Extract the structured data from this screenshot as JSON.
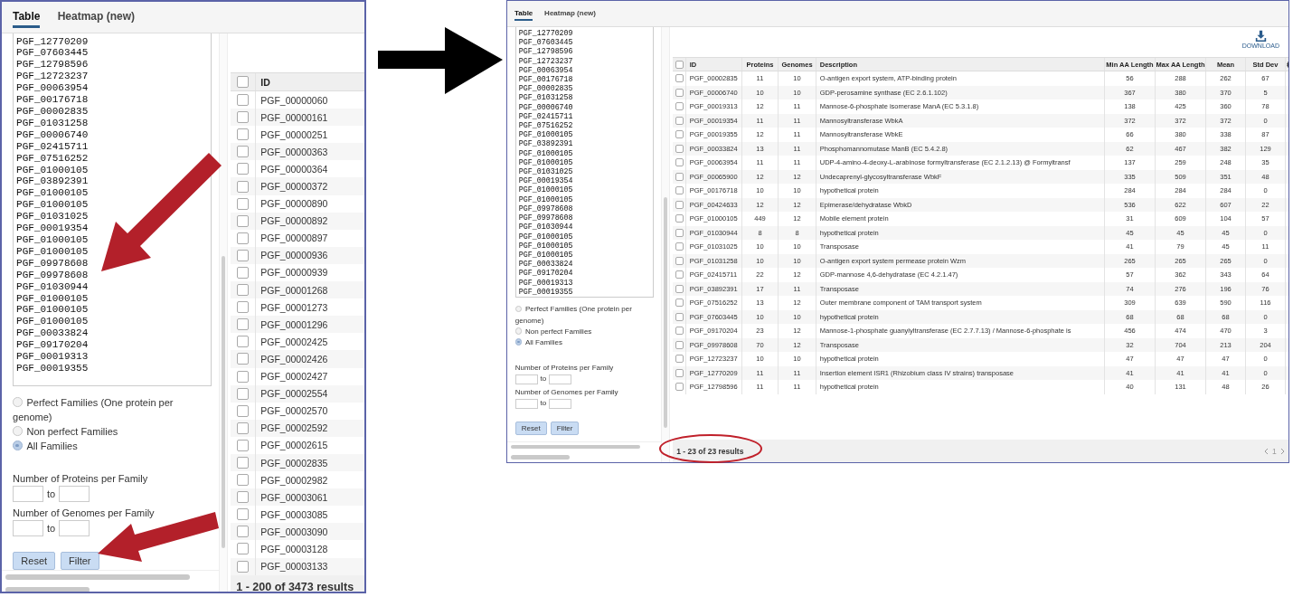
{
  "screens": [
    {
      "tabs": [
        {
          "label": "Table",
          "selected": true
        },
        {
          "label": "Heatmap (new)",
          "selected": false
        }
      ],
      "id_list": [
        "PGF_12770209",
        "PGF_07603445",
        "PGF_12798596",
        "PGF_12723237",
        "PGF_00063954",
        "PGF_00176718",
        "PGF_00002835",
        "PGF_01031258",
        "PGF_00006740",
        "PGF_02415711",
        "PGF_07516252",
        "PGF_01000105",
        "PGF_03892391",
        "PGF_01000105",
        "PGF_01000105",
        "PGF_01031025",
        "PGF_00019354",
        "PGF_01000105",
        "PGF_01000105",
        "PGF_09978608",
        "PGF_09978608",
        "PGF_01030944",
        "PGF_01000105",
        "PGF_01000105",
        "PGF_01000105",
        "PGF_00033824",
        "PGF_09170204",
        "PGF_00019313",
        "PGF_00019355"
      ],
      "family_options": [
        {
          "label": "Perfect Families (One protein per genome)",
          "selected": false
        },
        {
          "label": "Non perfect Families",
          "selected": false
        },
        {
          "label": "All Families",
          "selected": true
        }
      ],
      "ranges": [
        {
          "label": "Number of Proteins per Family",
          "to": "to"
        },
        {
          "label": "Number of Genomes per Family",
          "to": "to"
        }
      ],
      "buttons": [
        "Reset",
        "Filter"
      ],
      "table": {
        "select_all": {
          "checked": false
        },
        "columns": [
          "ID"
        ],
        "rows": [
          {
            "checked": false,
            "cells": [
              "PGF_00000060"
            ]
          },
          {
            "checked": false,
            "cells": [
              "PGF_00000161"
            ]
          },
          {
            "checked": false,
            "cells": [
              "PGF_00000251"
            ]
          },
          {
            "checked": false,
            "cells": [
              "PGF_00000363"
            ]
          },
          {
            "checked": false,
            "cells": [
              "PGF_00000364"
            ]
          },
          {
            "checked": false,
            "cells": [
              "PGF_00000372"
            ]
          },
          {
            "checked": false,
            "cells": [
              "PGF_00000890"
            ]
          },
          {
            "checked": false,
            "cells": [
              "PGF_00000892"
            ]
          },
          {
            "checked": false,
            "cells": [
              "PGF_00000897"
            ]
          },
          {
            "checked": false,
            "cells": [
              "PGF_00000936"
            ]
          },
          {
            "checked": false,
            "cells": [
              "PGF_00000939"
            ]
          },
          {
            "checked": false,
            "cells": [
              "PGF_00001268"
            ]
          },
          {
            "checked": false,
            "cells": [
              "PGF_00001273"
            ]
          },
          {
            "checked": false,
            "cells": [
              "PGF_00001296"
            ]
          },
          {
            "checked": false,
            "cells": [
              "PGF_00002425"
            ]
          },
          {
            "checked": false,
            "cells": [
              "PGF_00002426"
            ]
          },
          {
            "checked": false,
            "cells": [
              "PGF_00002427"
            ]
          },
          {
            "checked": false,
            "cells": [
              "PGF_00002554"
            ]
          },
          {
            "checked": false,
            "cells": [
              "PGF_00002570"
            ]
          },
          {
            "checked": false,
            "cells": [
              "PGF_00002592"
            ]
          },
          {
            "checked": false,
            "cells": [
              "PGF_00002615"
            ]
          },
          {
            "checked": false,
            "cells": [
              "PGF_00002835"
            ]
          },
          {
            "checked": false,
            "cells": [
              "PGF_00002982"
            ]
          },
          {
            "checked": false,
            "cells": [
              "PGF_00003061"
            ]
          },
          {
            "checked": false,
            "cells": [
              "PGF_00003085"
            ]
          },
          {
            "checked": false,
            "cells": [
              "PGF_00003090"
            ]
          },
          {
            "checked": false,
            "cells": [
              "PGF_00003128"
            ]
          },
          {
            "checked": false,
            "cells": [
              "PGF_00003133"
            ]
          }
        ]
      },
      "results": "1 - 200 of 3473 results"
    },
    {
      "tabs": [
        {
          "label": "Table",
          "selected": true
        },
        {
          "label": "Heatmap (new)",
          "selected": false
        }
      ],
      "id_list": [
        "PGF_12770209",
        "PGF_07603445",
        "PGF_12798596",
        "PGF_12723237",
        "PGF_00063954",
        "PGF_00176718",
        "PGF_00002835",
        "PGF_01031258",
        "PGF_00006740",
        "PGF_02415711",
        "PGF_07516252",
        "PGF_01000105",
        "PGF_03892391",
        "PGF_01000105",
        "PGF_01000105",
        "PGF_01031025",
        "PGF_00019354",
        "PGF_01000105",
        "PGF_01000105",
        "PGF_09978608",
        "PGF_09978608",
        "PGF_01030944",
        "PGF_01000105",
        "PGF_01000105",
        "PGF_01000105",
        "PGF_00033824",
        "PGF_09170204",
        "PGF_00019313",
        "PGF_00019355"
      ],
      "family_options": [
        {
          "label": "Perfect Families (One protein per genome)",
          "selected": false
        },
        {
          "label": "Non perfect Families",
          "selected": false
        },
        {
          "label": "All Families",
          "selected": true
        }
      ],
      "ranges": [
        {
          "label": "Number of Proteins per Family",
          "to": "to"
        },
        {
          "label": "Number of Genomes per Family",
          "to": "to"
        }
      ],
      "buttons": [
        "Reset",
        "Filter"
      ],
      "download": "DOWNLOAD",
      "table": {
        "select_all": {
          "checked": false
        },
        "columns": [
          "ID",
          "Proteins",
          "Genomes",
          "Description",
          "Min AA Length",
          "Max AA Length",
          "Mean",
          "Std Dev"
        ],
        "rows": [
          {
            "checked": false,
            "cells": [
              "PGF_00002835",
              "11",
              "10",
              "O-antigen export system, ATP-binding protein",
              "56",
              "288",
              "262",
              "67"
            ]
          },
          {
            "checked": false,
            "cells": [
              "PGF_00006740",
              "10",
              "10",
              "GDP-perosamine synthase (EC 2.6.1.102)",
              "367",
              "380",
              "370",
              "5"
            ]
          },
          {
            "checked": false,
            "cells": [
              "PGF_00019313",
              "12",
              "11",
              "Mannose-6-phosphate isomerase ManA (EC 5.3.1.8)",
              "138",
              "425",
              "360",
              "78"
            ]
          },
          {
            "checked": false,
            "cells": [
              "PGF_00019354",
              "11",
              "11",
              "Mannosyltransferase WbkA",
              "372",
              "372",
              "372",
              "0"
            ]
          },
          {
            "checked": false,
            "cells": [
              "PGF_00019355",
              "12",
              "11",
              "Mannosyltransferase WbkE",
              "66",
              "380",
              "338",
              "87"
            ]
          },
          {
            "checked": false,
            "cells": [
              "PGF_00033824",
              "13",
              "11",
              "Phosphomannomutase ManB (EC 5.4.2.8)",
              "62",
              "467",
              "382",
              "129"
            ]
          },
          {
            "checked": false,
            "cells": [
              "PGF_00063954",
              "11",
              "11",
              "UDP-4-amino-4-deoxy-L-arabinose formyltransferase (EC 2.1.2.13) @ Formyltransf",
              "137",
              "259",
              "248",
              "35"
            ]
          },
          {
            "checked": false,
            "cells": [
              "PGF_00065900",
              "12",
              "12",
              "Undecaprenyl-glycosyltransferase WbkF",
              "335",
              "509",
              "351",
              "48"
            ]
          },
          {
            "checked": false,
            "cells": [
              "PGF_00176718",
              "10",
              "10",
              "hypothetical protein",
              "284",
              "284",
              "284",
              "0"
            ]
          },
          {
            "checked": false,
            "cells": [
              "PGF_00424633",
              "12",
              "12",
              "Epimerase/dehydratase WbkD",
              "536",
              "622",
              "607",
              "22"
            ]
          },
          {
            "checked": false,
            "cells": [
              "PGF_01000105",
              "449",
              "12",
              "Mobile element protein",
              "31",
              "609",
              "104",
              "57"
            ]
          },
          {
            "checked": false,
            "cells": [
              "PGF_01030944",
              "8",
              "8",
              "hypothetical protein",
              "45",
              "45",
              "45",
              "0"
            ]
          },
          {
            "checked": false,
            "cells": [
              "PGF_01031025",
              "10",
              "10",
              "Transposase",
              "41",
              "79",
              "45",
              "11"
            ]
          },
          {
            "checked": false,
            "cells": [
              "PGF_01031258",
              "10",
              "10",
              "O-antigen export system permease protein Wzm",
              "265",
              "265",
              "265",
              "0"
            ]
          },
          {
            "checked": false,
            "cells": [
              "PGF_02415711",
              "22",
              "12",
              "GDP-mannose 4,6-dehydratase (EC 4.2.1.47)",
              "57",
              "362",
              "343",
              "64"
            ]
          },
          {
            "checked": false,
            "cells": [
              "PGF_03892391",
              "17",
              "11",
              "Transposase",
              "74",
              "276",
              "196",
              "76"
            ]
          },
          {
            "checked": false,
            "cells": [
              "PGF_07516252",
              "13",
              "12",
              "Outer membrane component of TAM transport system",
              "309",
              "639",
              "590",
              "116"
            ]
          },
          {
            "checked": false,
            "cells": [
              "PGF_07603445",
              "10",
              "10",
              "hypothetical protein",
              "68",
              "68",
              "68",
              "0"
            ]
          },
          {
            "checked": false,
            "cells": [
              "PGF_09170204",
              "23",
              "12",
              "Mannose-1-phosphate guanylyltransferase (EC 2.7.7.13) / Mannose-6-phosphate is",
              "456",
              "474",
              "470",
              "3"
            ]
          },
          {
            "checked": false,
            "cells": [
              "PGF_09978608",
              "70",
              "12",
              "Transposase",
              "32",
              "704",
              "213",
              "204"
            ]
          },
          {
            "checked": false,
            "cells": [
              "PGF_12723237",
              "10",
              "10",
              "hypothetical protein",
              "47",
              "47",
              "47",
              "0"
            ]
          },
          {
            "checked": false,
            "cells": [
              "PGF_12770209",
              "11",
              "11",
              "Insertion element ISR1 (Rhizobium class IV strains) transposase",
              "41",
              "41",
              "41",
              "0"
            ]
          },
          {
            "checked": false,
            "cells": [
              "PGF_12798596",
              "11",
              "11",
              "hypothetical protein",
              "40",
              "131",
              "48",
              "26"
            ]
          }
        ]
      },
      "results": "1 - 23 of 23 results",
      "page": "1"
    }
  ]
}
